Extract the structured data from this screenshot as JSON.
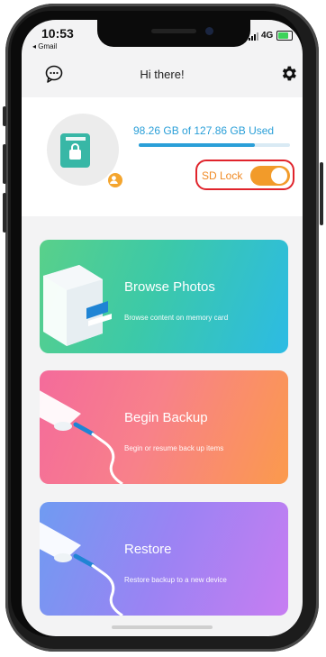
{
  "status_bar": {
    "time": "10:53",
    "back_app": "◂ Gmail",
    "network": "4G",
    "battery_color": "#3cd35a"
  },
  "header": {
    "title": "Hi there!",
    "left_icon": "chat-bubble-icon",
    "right_icon": "gear-icon"
  },
  "storage": {
    "usage_text": "98.26 GB of 127.86 GB Used",
    "used_fraction": 0.768,
    "sd_lock_label": "SD Lock",
    "sd_lock_on": true,
    "accent_color": "#2a9fd8",
    "toggle_color": "#f29b2a",
    "highlight_color": "#e0242c"
  },
  "tiles": [
    {
      "title": "Browse Photos",
      "subtitle": "Browse content on memory card"
    },
    {
      "title": "Begin Backup",
      "subtitle": "Begin or resume back up items"
    },
    {
      "title": "Restore",
      "subtitle": "Restore backup to a new device"
    }
  ]
}
